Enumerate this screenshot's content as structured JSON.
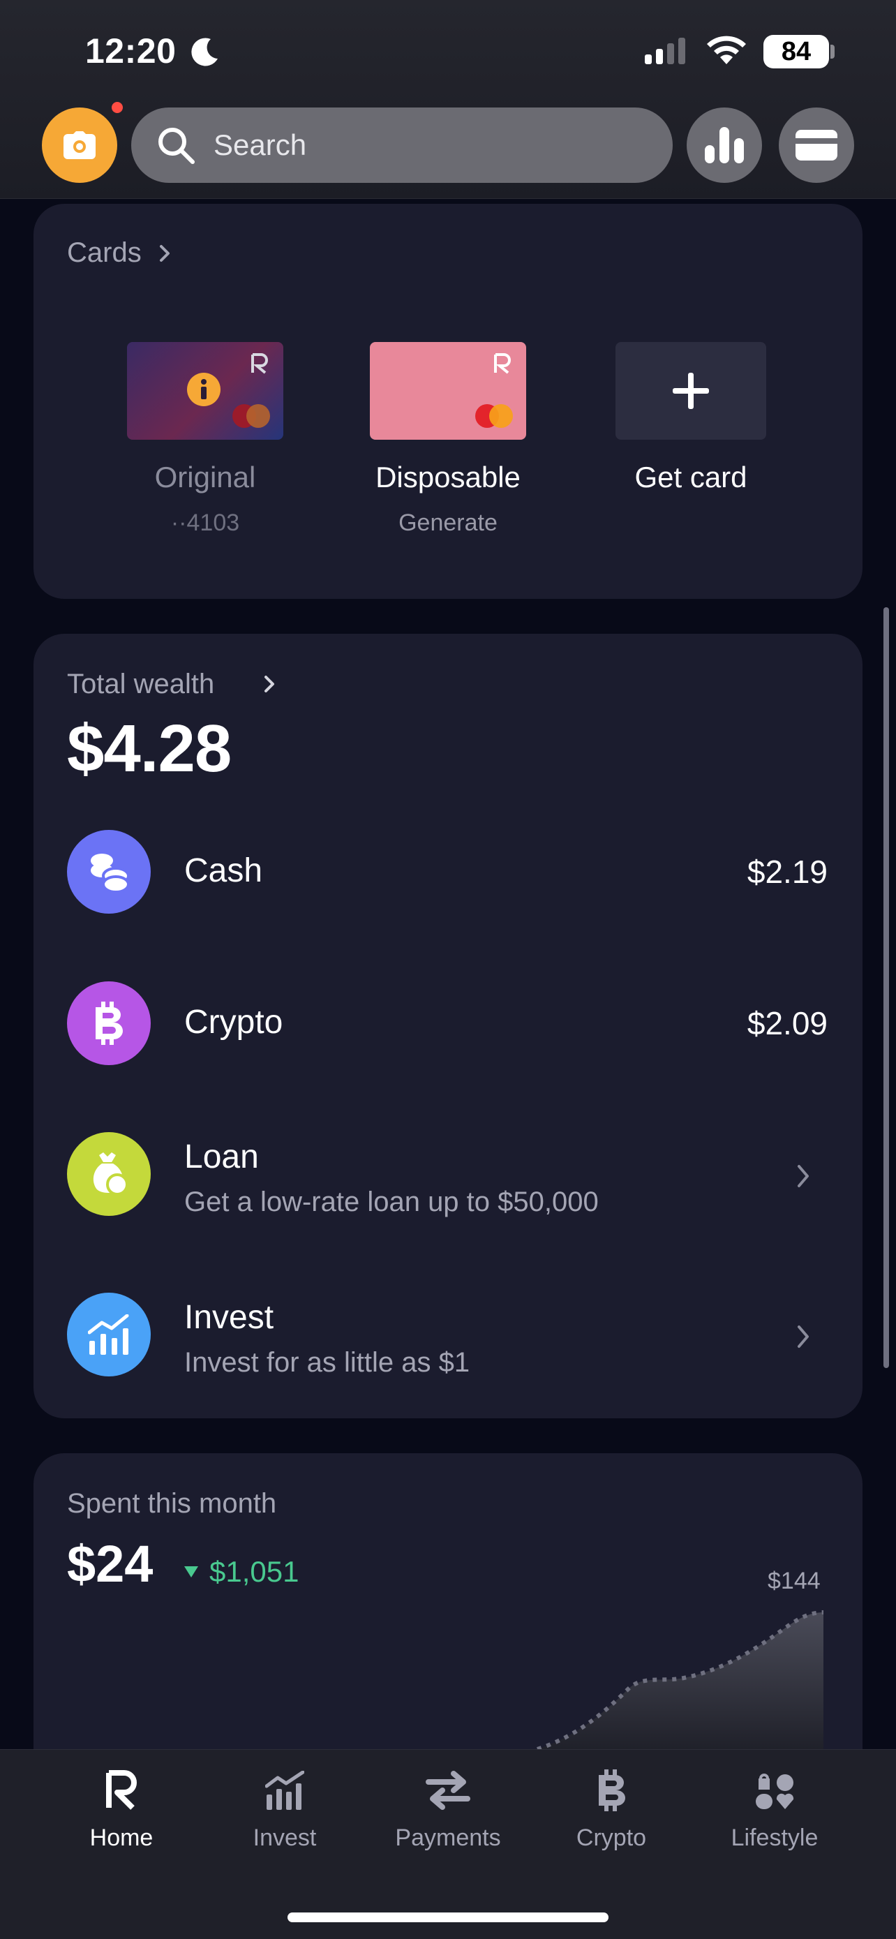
{
  "status_bar": {
    "time": "12:20",
    "battery": "84"
  },
  "header": {
    "search_placeholder": "Search"
  },
  "cards": {
    "title": "Cards",
    "items": [
      {
        "label": "Original",
        "sub": "··4103"
      },
      {
        "label": "Disposable",
        "sub": "Generate"
      },
      {
        "label": "Get card",
        "sub": ""
      }
    ]
  },
  "wealth": {
    "title": "Total wealth",
    "amount": "$4.28",
    "rows": [
      {
        "title": "Cash",
        "value": "$2.19",
        "icon": "coins-icon",
        "color": "#6b73f5"
      },
      {
        "title": "Crypto",
        "value": "$2.09",
        "icon": "bitcoin-icon",
        "color": "#b656e6"
      },
      {
        "title": "Loan",
        "sub": "Get a low-rate loan up to $50,000",
        "icon": "money-bag-icon",
        "color": "#c4d93b"
      },
      {
        "title": "Invest",
        "sub": "Invest for as little as $1",
        "icon": "chart-bars-icon",
        "color": "#4aa2f7"
      }
    ]
  },
  "spent": {
    "title": "Spent this month",
    "amount": "$24",
    "delta": "$1,051",
    "chart_label": "$144"
  },
  "nav": [
    {
      "label": "Home",
      "icon": "revolut-logo-icon",
      "active": true
    },
    {
      "label": "Invest",
      "icon": "chart-icon"
    },
    {
      "label": "Payments",
      "icon": "transfer-arrows-icon"
    },
    {
      "label": "Crypto",
      "icon": "bitcoin-icon"
    },
    {
      "label": "Lifestyle",
      "icon": "lifestyle-icon"
    }
  ],
  "colors": {
    "background": "#080a18",
    "panel": "#1b1c2e",
    "accent_orange": "#f6a836",
    "positive_green": "#49c98f"
  }
}
